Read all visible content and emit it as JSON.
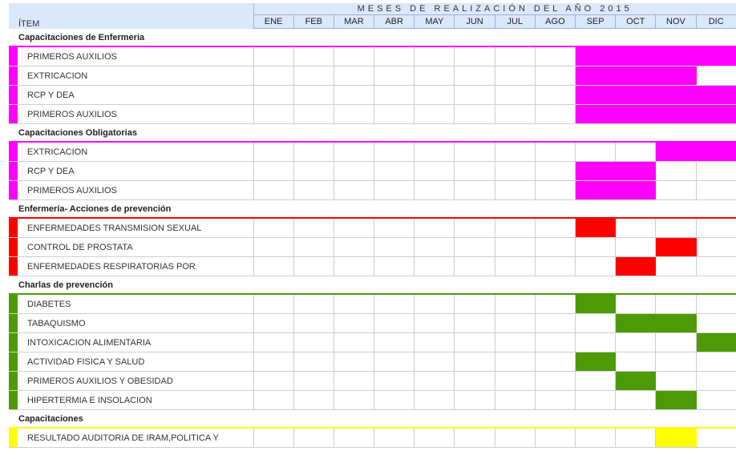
{
  "header": {
    "title": "MESES DE REALIZACIÓN DEL AÑO 2015",
    "item_label": "ÍTEM",
    "months": [
      "ENE",
      "FEB",
      "MAR",
      "ABR",
      "MAY",
      "JUN",
      "JUL",
      "AGO",
      "SEP",
      "OCT",
      "NOV",
      "DIC"
    ]
  },
  "colors": {
    "magenta": "#ff00ff",
    "red": "#ff0000",
    "green": "#4e9a06",
    "yellow": "#ffff00",
    "header_bg": "#dbe8fb"
  },
  "sections": [
    {
      "name": "Capacitaciones de Enfermeria",
      "color": "#ff00ff",
      "items": [
        {
          "label": "PRIMEROS AUXILIOS",
          "months": [
            "SEP",
            "OCT",
            "NOV",
            "DIC"
          ]
        },
        {
          "label": "EXTRICACION",
          "months": [
            "SEP",
            "OCT",
            "NOV"
          ]
        },
        {
          "label": "RCP Y DEA",
          "months": [
            "SEP",
            "OCT",
            "NOV",
            "DIC"
          ]
        },
        {
          "label": "PRIMEROS AUXILIOS",
          "months": [
            "SEP",
            "OCT",
            "NOV",
            "DIC"
          ]
        }
      ]
    },
    {
      "name": "Capacitaciones Obligatorias",
      "color": "#ff00ff",
      "items": [
        {
          "label": "EXTRICACION",
          "months": [
            "NOV",
            "DIC"
          ]
        },
        {
          "label": "RCP Y DEA",
          "months": [
            "SEP",
            "OCT"
          ]
        },
        {
          "label": "PRIMEROS AUXILIOS",
          "months": [
            "SEP",
            "OCT"
          ]
        }
      ]
    },
    {
      "name": "Enfermería- Acciones de prevención",
      "color": "#ff0000",
      "items": [
        {
          "label": "ENFERMEDADES TRANSMISION SEXUAL",
          "months": [
            "SEP"
          ]
        },
        {
          "label": "CONTROL DE PROSTATA",
          "months": [
            "NOV"
          ]
        },
        {
          "label": "ENFERMEDADES RESPIRATORIAS POR",
          "months": [
            "OCT"
          ]
        }
      ]
    },
    {
      "name": "Charlas de prevención",
      "color": "#4e9a06",
      "items": [
        {
          "label": "DIABETES",
          "months": [
            "SEP"
          ]
        },
        {
          "label": "TABAQUISMO",
          "months": [
            "OCT",
            "NOV"
          ]
        },
        {
          "label": "INTOXICACION ALIMENTARIA",
          "months": [
            "DIC"
          ]
        },
        {
          "label": "ACTIVIDAD FISICA Y SALUD",
          "months": [
            "SEP"
          ]
        },
        {
          "label": "PRIMEROS AUXILIOS Y OBESIDAD",
          "months": [
            "OCT"
          ]
        },
        {
          "label": "HIPERTERMIA E INSOLACION",
          "months": [
            "NOV"
          ]
        }
      ]
    },
    {
      "name": "Capacitaciones",
      "color": "#ffff00",
      "items": [
        {
          "label": "RESULTADO AUDITORIA DE IRAM,POLITICA Y",
          "months": [
            "NOV"
          ]
        }
      ]
    }
  ]
}
